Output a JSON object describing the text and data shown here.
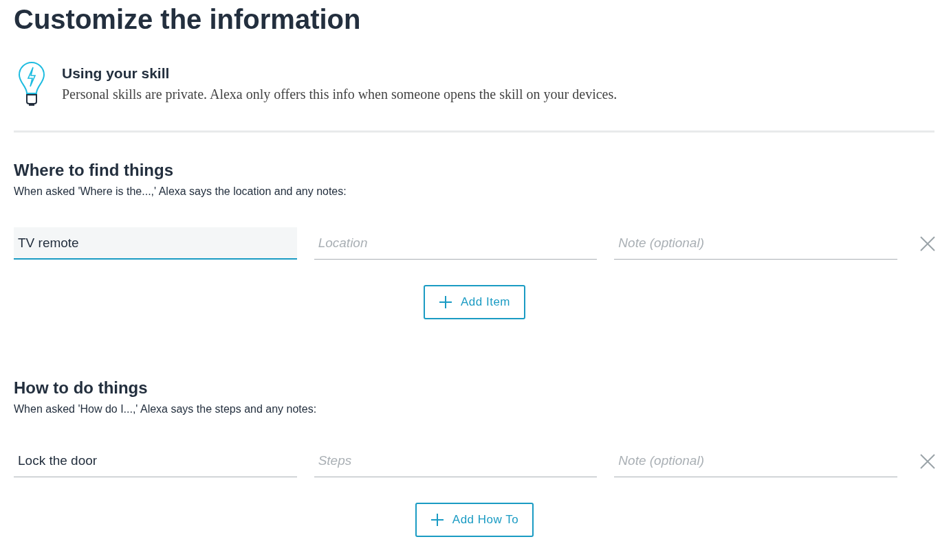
{
  "page": {
    "title": "Customize the information"
  },
  "info": {
    "title": "Using your skill",
    "text": "Personal skills are private. Alexa only offers this info when someone opens the skill on your devices."
  },
  "sections": [
    {
      "title": "Where to find things",
      "description": "When asked 'Where is the...,' Alexa says the location and any notes:",
      "rows": [
        {
          "fields": [
            {
              "value": "TV remote",
              "focused": true
            },
            {
              "placeholder": "Location",
              "focused": false
            },
            {
              "placeholder": "Note (optional)",
              "focused": false
            }
          ]
        }
      ],
      "add_button": "Add Item"
    },
    {
      "title": "How to do things",
      "description": "When asked 'How do I...,' Alexa says the steps and any notes:",
      "rows": [
        {
          "fields": [
            {
              "value": "Lock the door",
              "focused": false
            },
            {
              "placeholder": "Steps",
              "focused": false
            },
            {
              "placeholder": "Note (optional)",
              "focused": false
            }
          ]
        }
      ],
      "add_button": "Add How To"
    }
  ]
}
